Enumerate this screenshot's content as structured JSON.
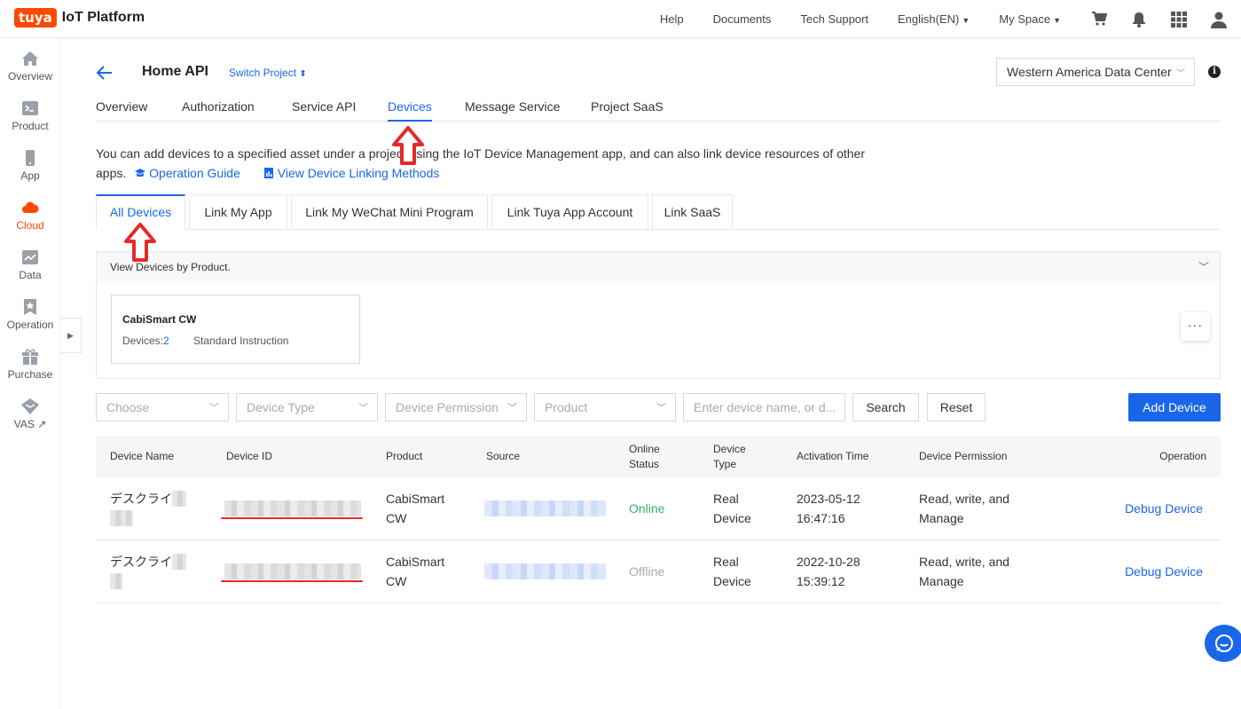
{
  "brand": {
    "badge": "tuya",
    "name": "IoT Platform"
  },
  "topnav": {
    "help": "Help",
    "documents": "Documents",
    "tech_support": "Tech Support",
    "language": "English(EN)",
    "my_space": "My Space"
  },
  "sidebar": {
    "items": [
      {
        "label": "Overview",
        "icon": "home-icon"
      },
      {
        "label": "Product",
        "icon": "terminal-icon"
      },
      {
        "label": "App",
        "icon": "phone-icon"
      },
      {
        "label": "Cloud",
        "icon": "cloud-icon",
        "active": true
      },
      {
        "label": "Data",
        "icon": "chart-icon"
      },
      {
        "label": "Operation",
        "icon": "star-badge-icon"
      },
      {
        "label": "Purchase",
        "icon": "gift-icon"
      },
      {
        "label": "VAS ↗",
        "icon": "diamond-icon"
      }
    ]
  },
  "project": {
    "title": "Home API",
    "switch_label": "Switch Project",
    "data_center": "Western America Data Center"
  },
  "main_tabs": [
    "Overview",
    "Authorization",
    "Service API",
    "Devices",
    "Message Service",
    "Project SaaS"
  ],
  "description": {
    "text": "You can add devices to a specified asset under a project using the IoT Device Management app, and can also link device resources of other apps.",
    "operation_guide": "Operation Guide",
    "view_linking": "View Device Linking Methods"
  },
  "sub_tabs": [
    "All Devices",
    "Link My App",
    "Link My WeChat Mini Program",
    "Link Tuya App Account",
    "Link SaaS"
  ],
  "product_panel": {
    "header": "View Devices by Product.",
    "card": {
      "name": "CabiSmart CW",
      "devices_label": "Devices:",
      "devices_count": "2",
      "type": "Standard Instruction"
    },
    "more": "···"
  },
  "filters": {
    "choose": "Choose",
    "device_type": "Device Type",
    "device_permission": "Device Permission",
    "product": "Product",
    "search_placeholder": "Enter device name, or d...",
    "search_btn": "Search",
    "reset_btn": "Reset",
    "add_device_btn": "Add Device"
  },
  "table": {
    "headers": {
      "device_name": "Device Name",
      "device_id": "Device ID",
      "product": "Product",
      "source": "Source",
      "online_status": [
        "Online",
        "Status"
      ],
      "device_type": [
        "Device",
        "Type"
      ],
      "activation_time": "Activation Time",
      "device_permission": "Device Permission",
      "operation": "Operation"
    },
    "rows": [
      {
        "name": "デスクライト",
        "product": [
          "CabiSmart",
          "CW"
        ],
        "status": "Online",
        "type": [
          "Real",
          "Device"
        ],
        "time": [
          "2023-05-12",
          "16:47:16"
        ],
        "permission": [
          "Read, write, and",
          "Manage"
        ],
        "operation": "Debug Device"
      },
      {
        "name": "デスクライト",
        "product": [
          "CabiSmart",
          "CW"
        ],
        "status": "Offline",
        "type": [
          "Real",
          "Device"
        ],
        "time": [
          "2022-10-28",
          "15:39:12"
        ],
        "permission": [
          "Read, write, and",
          "Manage"
        ],
        "operation": "Debug Device"
      }
    ]
  },
  "colors": {
    "brand_orange": "#ff4800",
    "link_blue": "#1a66e8",
    "online_green": "#2fb36b",
    "annotation_red": "#e32a2a"
  }
}
